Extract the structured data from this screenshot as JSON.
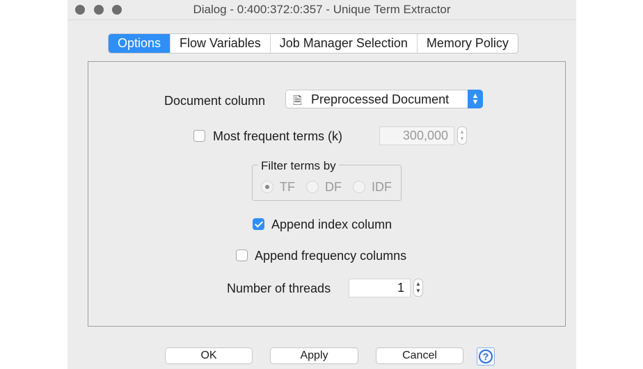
{
  "window": {
    "title": "Dialog - 0:400:372:0:357 - Unique Term Extractor"
  },
  "tabs": [
    {
      "label": "Options",
      "active": true
    },
    {
      "label": "Flow Variables",
      "active": false
    },
    {
      "label": "Job Manager Selection",
      "active": false
    },
    {
      "label": "Memory Policy",
      "active": false
    }
  ],
  "options": {
    "document_column_label": "Document column",
    "document_column_value": "Preprocessed Document",
    "document_column_icon": "document-icon",
    "most_frequent_label": "Most frequent terms (k)",
    "most_frequent_checked": false,
    "most_frequent_value": "300,000",
    "filter_group_label": "Filter terms by",
    "filter_options": [
      "TF",
      "DF",
      "IDF"
    ],
    "filter_selected": "TF",
    "append_index_label": "Append index column",
    "append_index_checked": true,
    "append_frequency_label": "Append frequency columns",
    "append_frequency_checked": false,
    "threads_label": "Number of threads",
    "threads_value": "1"
  },
  "buttons": {
    "ok": "OK",
    "apply": "Apply",
    "cancel": "Cancel",
    "help": "?"
  },
  "colors": {
    "accent": "#2f8ff7",
    "window_bg": "#ececec"
  }
}
